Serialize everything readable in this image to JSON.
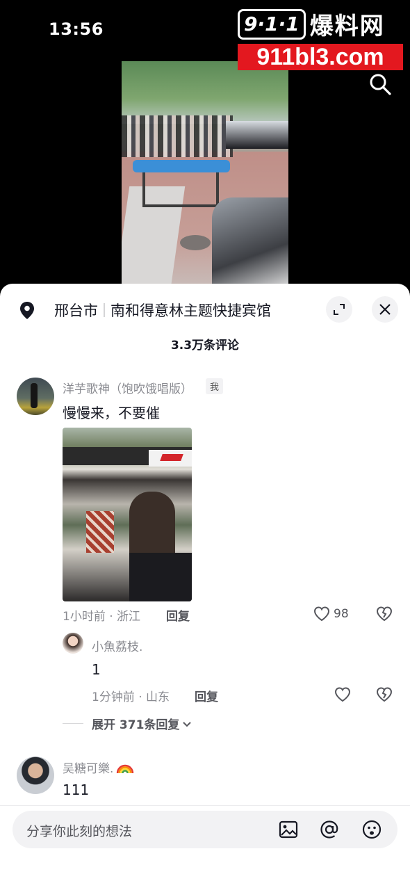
{
  "status_bar": {
    "time": "13:56"
  },
  "watermark": {
    "badge": "9·1·1",
    "name": "爆料网",
    "url": "911bl3.com"
  },
  "colors": {
    "accent": "#e3181f",
    "text_primary": "#161823",
    "text_secondary": "#8a8b91",
    "sheet_bg": "#ffffff"
  },
  "icons": {
    "search": "search-icon",
    "location": "location-pin-icon",
    "expand": "expand-icon",
    "close": "close-icon",
    "like": "heart-icon",
    "dislike": "broken-heart-icon",
    "chevron": "chevron-down-icon",
    "image": "image-icon",
    "at": "at-icon",
    "emoji": "emoji-icon"
  },
  "location": {
    "city": "邢台市",
    "place": "南和得意林主题快捷宾馆"
  },
  "comments_header": {
    "count_label": "3.3万条评论"
  },
  "comments": [
    {
      "username": "洋芋歌神（饱吹饿唱版）",
      "tag": "我",
      "text": "慢慢来，不要催",
      "time_loc": "1小时前 · 浙江",
      "reply_label": "回复",
      "likes": "98",
      "replies": [
        {
          "username": "小魚荔枝.",
          "text": "1",
          "time_loc": "1分钟前 · 山东",
          "reply_label": "回复"
        }
      ],
      "expand_label": "展开 371条回复"
    },
    {
      "username": "吴糖可樂.",
      "text": "111"
    }
  ],
  "input": {
    "placeholder": "分享你此刻的想法"
  }
}
